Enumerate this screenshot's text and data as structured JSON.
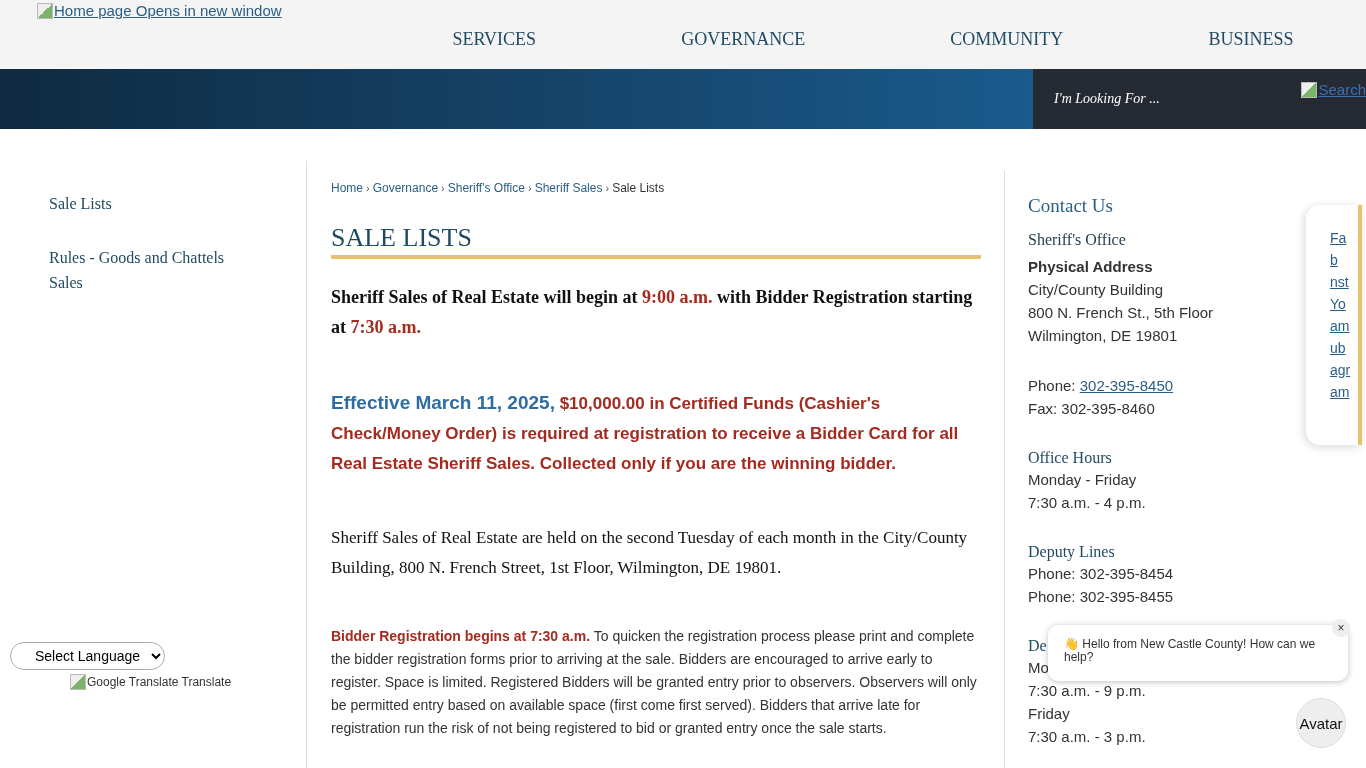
{
  "header": {
    "logo_alt": "Home page Opens in new window",
    "nav": [
      "SERVICES",
      "GOVERNANCE",
      "COMMUNITY",
      "BUSINESS"
    ]
  },
  "search": {
    "placeholder": "I'm Looking For ...",
    "button": "Search"
  },
  "sidebar": {
    "items": [
      {
        "label": "Sale Lists"
      },
      {
        "label": "Rules - Goods and Chattels Sales"
      }
    ],
    "language_select": "Select Language",
    "translate": "Google Translate Translate"
  },
  "breadcrumb": {
    "links": [
      "Home",
      "Governance",
      "Sheriff's Office",
      "Sheriff Sales"
    ],
    "current": "Sale Lists",
    "separator": "›"
  },
  "title": "SALE LISTS",
  "paragraphs": [
    {
      "kind": "lead",
      "segments": [
        {
          "text": "Sheriff Sales of Real Estate will begin at ",
          "color": "#111111"
        },
        {
          "text": "9:00 a.m.",
          "color": "#a52a1f"
        },
        {
          "text": " with Bidder Registration starting at ",
          "color": "#111111"
        },
        {
          "text": "7:30 a.m.",
          "color": "#a52a1f"
        }
      ]
    },
    {
      "kind": "notice",
      "segments": [
        {
          "text": "Effective March 11, 2025,",
          "color": "#2e6da4"
        },
        {
          "text": " $10,000.00 in Certified Funds (Cashier's Check/Money Order) is required at registration to receive a Bidder Card for all Real Estate Sheriff Sales. Collected only if you are the winning bidder.",
          "color": "#a52a1f"
        }
      ]
    },
    {
      "kind": "body",
      "segments": [
        {
          "text": "Sheriff Sales of Real Estate are held on the second Tuesday of each month in the City/County Building, 800 N. French Street, 1st Floor, Wilmington, DE 19801.",
          "color": "#111111"
        }
      ]
    },
    {
      "kind": "small",
      "segments": [
        {
          "text": "Bidder Registration begins at 7:30 a.m.",
          "color": "#a52a1f"
        },
        {
          "text": "  To quicken the registration process please print and complete the bidder registration forms prior to arriving at the sale.  Bidders are encouraged to arrive early to register.  Space is limited. Registered Bidders will be granted entry prior to observers. Observers will only be permitted entry based on available space (first come first served).  Bidders that arrive late for registration run the risk of not being registered to bid or granted entry once the sale starts.",
          "color": "#333333"
        }
      ]
    }
  ],
  "contact": {
    "title": "Contact Us",
    "office": "Sheriff's Office",
    "address_label": "Physical Address",
    "address": [
      "City/County Building",
      "800 N. French St., 5th Floor",
      "Wilmington, DE 19801"
    ],
    "phone_label": "Phone: ",
    "phone": "302-395-8450",
    "fax": "Fax: 302-395-8460",
    "sections": [
      {
        "heading": "Office Hours",
        "lines": [
          "Monday - Friday",
          "7:30 a.m. - 4 p.m."
        ]
      },
      {
        "heading": "Deputy Lines",
        "lines": [
          "Phone: 302-395-8454",
          "Phone: 302-395-8455"
        ]
      },
      {
        "heading": "De",
        "lines": [
          "Mo",
          "7:30 a.m. - 9 p.m.",
          "Friday",
          "7:30 a.m. - 3 p.m."
        ]
      }
    ]
  },
  "social": [
    "Fa",
    "b",
    "nst",
    "Yo",
    "am",
    "ub",
    "agr",
    "am"
  ],
  "chat": {
    "message": "👋 Hello from New Castle County! How can we help?",
    "close": "×",
    "avatar": "Avatar"
  }
}
